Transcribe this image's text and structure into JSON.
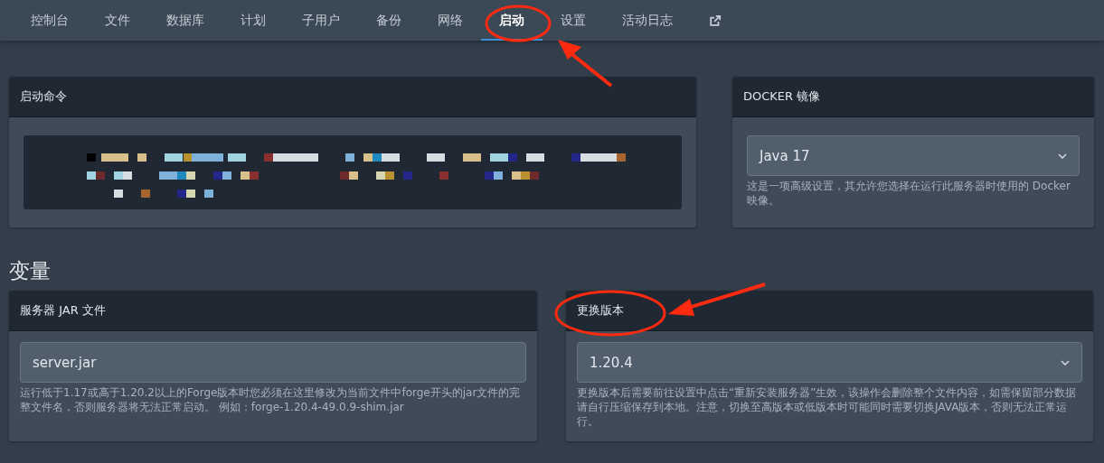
{
  "tabs": [
    {
      "label": "控制台",
      "selected": false
    },
    {
      "label": "文件",
      "selected": false
    },
    {
      "label": "数据库",
      "selected": false
    },
    {
      "label": "计划",
      "selected": false
    },
    {
      "label": "子用户",
      "selected": false
    },
    {
      "label": "备份",
      "selected": false
    },
    {
      "label": "网络",
      "selected": false
    },
    {
      "label": "启动",
      "selected": true
    },
    {
      "label": "设置",
      "selected": false
    },
    {
      "label": "活动日志",
      "selected": false
    }
  ],
  "startup_command": {
    "title": "启动命令"
  },
  "docker_image": {
    "title": "DOCKER 镜像",
    "value": "Java 17",
    "help": "这是一项高级设置，其允许您选择在运行此服务器时使用的 Docker 映像。"
  },
  "variables_heading": "变量",
  "variables": [
    {
      "kind": "input",
      "title": "服务器 JAR 文件",
      "value": "server.jar",
      "help": "运行低于1.17或高于1.20.2以上的Forge版本时您必须在这里修改为当前文件中forge开头的jar文件的完整文件名，否则服务器将无法正常启动。 例如：forge-1.20.4-49.0.9-shim.jar"
    },
    {
      "kind": "select",
      "title": "更换版本",
      "value": "1.20.4",
      "help": "更换版本后需要前往设置中点击“重新安装服务器”生效，该操作会删除整个文件内容，如需保留部分数据请自行压缩保存到本地。注意，切换至高版本或低版本时可能同时需要切换JAVA版本，否则无法正常运行。"
    }
  ]
}
